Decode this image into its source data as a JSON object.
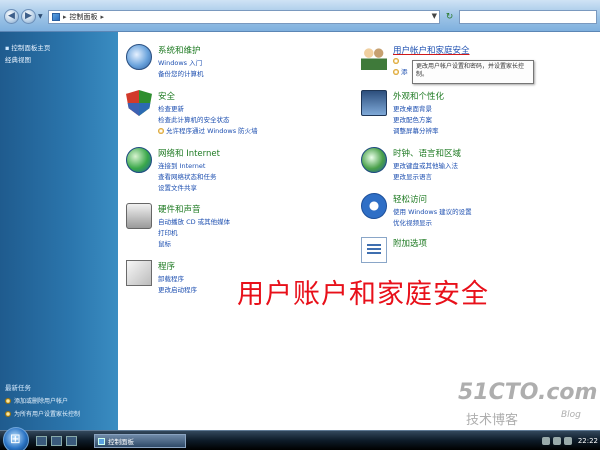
{
  "address": {
    "breadcrumb": "控制面板",
    "search_placeholder": ""
  },
  "leftpane": {
    "items": [
      "控制面板主页",
      "经典视图"
    ],
    "see_also_title": "最新任务",
    "see_also": [
      "添加或删除用户帐户",
      "为所有用户设置家长控制"
    ]
  },
  "categories": {
    "system": {
      "title": "系统和维护",
      "links": [
        "Windows 入门",
        "备份您的计算机"
      ]
    },
    "security": {
      "title": "安全",
      "links": [
        "检查更新",
        "检查此计算机的安全状态",
        "允许程序通过 Windows 防火墙"
      ]
    },
    "network": {
      "title": "网络和 Internet",
      "links": [
        "连接到 Internet",
        "查看网络状态和任务",
        "设置文件共享"
      ]
    },
    "hardware": {
      "title": "硬件和声音",
      "links": [
        "自动播放 CD 或其他媒体",
        "打印机",
        "鼠标"
      ]
    },
    "programs": {
      "title": "程序",
      "links": [
        "卸载程序",
        "更改启动程序"
      ]
    },
    "users": {
      "title": "用户帐户和家庭安全",
      "links": [
        "",
        "添"
      ]
    },
    "appearance": {
      "title": "外观和个性化",
      "links": [
        "更改桌面背景",
        "更改配色方案",
        "调整屏幕分辨率"
      ]
    },
    "clock": {
      "title": "时钟、语言和区域",
      "links": [
        "更改键盘或其他输入法",
        "更改显示语言"
      ]
    },
    "access": {
      "title": "轻松访问",
      "links": [
        "使用 Windows 建议的设置",
        "优化视频显示"
      ]
    },
    "extra": {
      "title": "附加选项",
      "links": []
    }
  },
  "tooltip": "更改用户帐户设置和密码，并设置家长控制。",
  "caption": "用户账户和家庭安全",
  "watermark": {
    "a": "51CTO.com",
    "b": "技术博客",
    "c": "Blog"
  },
  "taskbar": {
    "task_label": "控制面板",
    "clock": "22:22"
  }
}
